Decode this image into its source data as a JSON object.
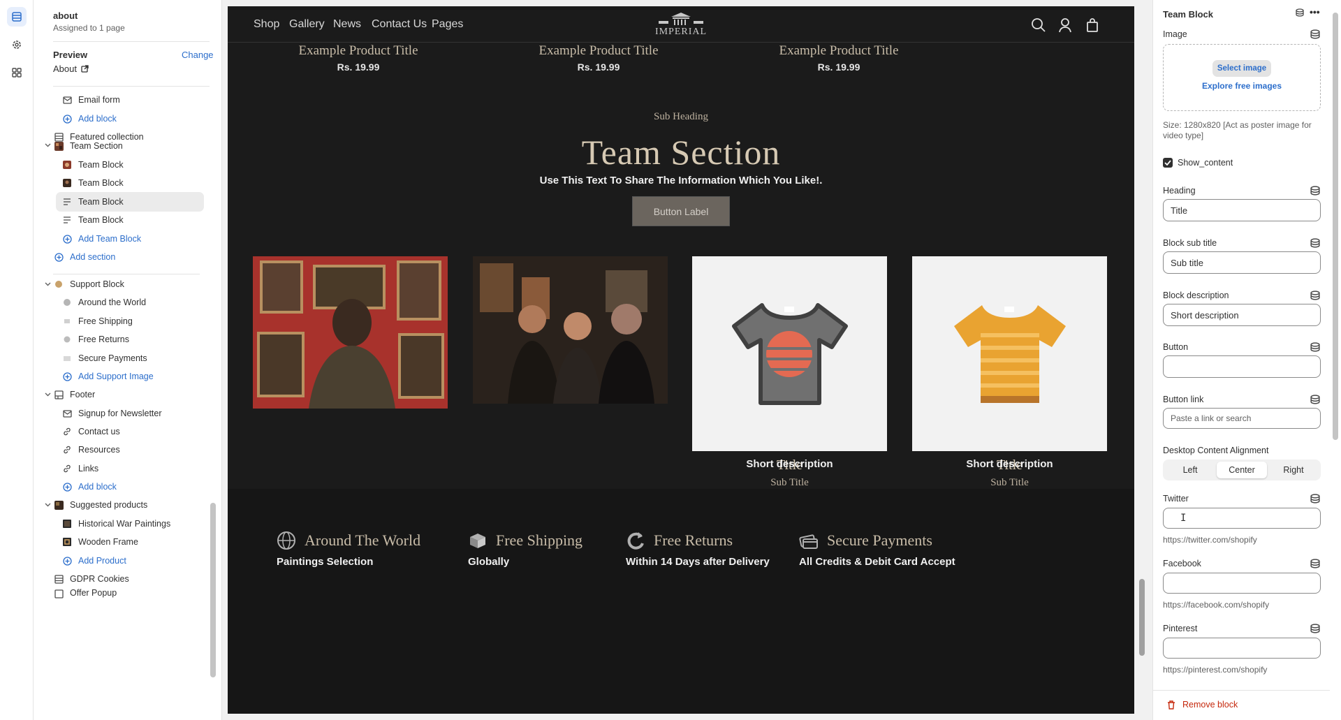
{
  "page": {
    "name": "about",
    "assigned": "Assigned to 1 page"
  },
  "preview": {
    "label": "Preview",
    "change": "Change",
    "value": "About"
  },
  "tree": {
    "email_form": "Email form",
    "add_block_1": "Add block",
    "featured_collection": "Featured collection",
    "team_section": "Team Section",
    "team_block_1": "Team Block",
    "team_block_2": "Team Block",
    "team_block_3": "Team Block",
    "team_block_4": "Team Block",
    "add_team_block": "Add Team Block",
    "add_section": "Add section",
    "support_block": "Support Block",
    "around_world": "Around the World",
    "free_shipping": "Free Shipping",
    "free_returns": "Free Returns",
    "secure_payments": "Secure Payments",
    "add_support_image": "Add Support Image",
    "footer": "Footer",
    "signup": "Signup for Newsletter",
    "contact": "Contact us",
    "resources": "Resources",
    "links": "Links",
    "add_block_2": "Add block",
    "suggested": "Suggested products",
    "historical": "Historical War Paintings",
    "wooden": "Wooden Frame",
    "add_product": "Add Product",
    "gdpr": "GDPR Cookies",
    "offer_popup": "Offer Popup"
  },
  "store": {
    "nav": [
      "Shop",
      "Gallery",
      "News",
      "Contact Us",
      "Pages"
    ],
    "logo": "IMPERIAL",
    "products": [
      {
        "title": "Example Product Title",
        "price": "Rs. 19.99"
      },
      {
        "title": "Example Product Title",
        "price": "Rs. 19.99"
      },
      {
        "title": "Example Product Title",
        "price": "Rs. 19.99"
      }
    ],
    "sub_heading": "Sub Heading",
    "team_title": "Team Section",
    "team_text": "Use This Text To Share The Information Which You Like!.",
    "button_label": "Button Label",
    "cards": [
      {
        "title": "Title",
        "sub": "Sub Title",
        "desc": "Short description"
      },
      {
        "title": "Title",
        "sub": "Sub Title",
        "desc": "Short description"
      }
    ],
    "features": [
      {
        "title": "Around The World",
        "sub": "Paintings Selection"
      },
      {
        "title": "Free Shipping",
        "sub": "Globally"
      },
      {
        "title": "Free Returns",
        "sub": "Within 14 Days after Delivery"
      },
      {
        "title": "Secure Payments",
        "sub": "All Credits & Debit Card Accept"
      }
    ]
  },
  "panel": {
    "title": "Team Block",
    "image_label": "Image",
    "select_image": "Select image",
    "explore": "Explore free images",
    "size_hint": "Size: 1280x820 [Act as poster image for video type]",
    "show_content": "Show_content",
    "heading_label": "Heading",
    "heading_value": "Title",
    "subtitle_label": "Block sub title",
    "subtitle_value": "Sub title",
    "desc_label": "Block description",
    "desc_value": "Short description",
    "button_label": "Button",
    "button_value": "",
    "link_label": "Button link",
    "link_placeholder": "Paste a link or search",
    "align_label": "Desktop Content Alignment",
    "align_options": [
      "Left",
      "Center",
      "Right"
    ],
    "align_selected": "Center",
    "twitter_label": "Twitter",
    "twitter_hint": "https://twitter.com/shopify",
    "facebook_label": "Facebook",
    "facebook_hint": "https://facebook.com/shopify",
    "pinterest_label": "Pinterest",
    "pinterest_hint": "https://pinterest.com/shopify",
    "remove": "Remove block"
  },
  "colors": {
    "accent": "#2c6ecb",
    "danger": "#c5280c",
    "store_bg": "#1b1b1b",
    "gold": "#d6c9b3"
  }
}
